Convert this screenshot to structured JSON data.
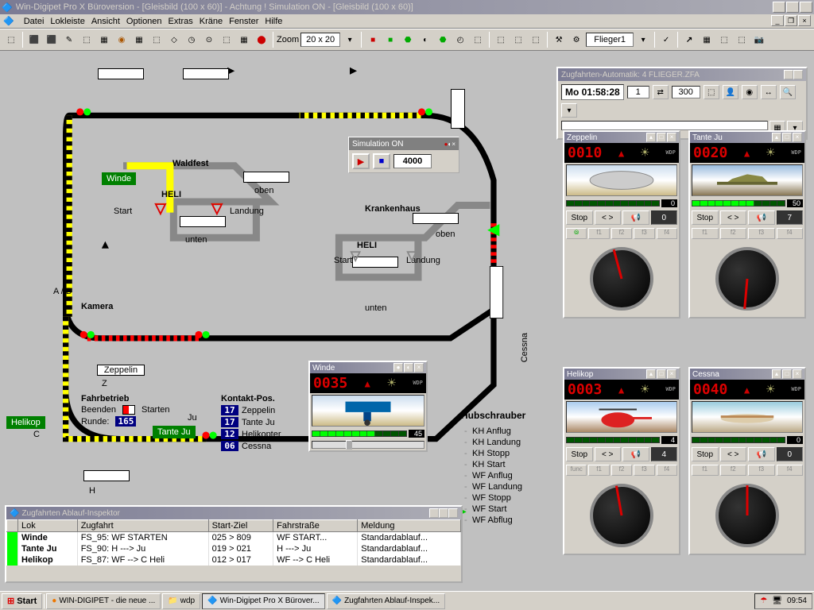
{
  "titlebar": "Win-Digipet Pro X Büroversion  - [Gleisbild (100 x 60)] - Achtung ! Simulation ON - [Gleisbild (100 x 60)]",
  "menu": [
    "Datei",
    "Lokleiste",
    "Ansicht",
    "Optionen",
    "Extras",
    "Kräne",
    "Fenster",
    "Hilfe"
  ],
  "toolbar": {
    "zoom_label": "Zoom",
    "zoom_value": "20 x 20",
    "flieger": "Flieger1"
  },
  "automation": {
    "title": "Zugfahrten-Automatik: 4 FLIEGER.ZFA",
    "clock": "Mo 01:58:28",
    "val1": "1",
    "val2": "300"
  },
  "simulation": {
    "title": "Simulation ON",
    "value": "4000"
  },
  "labels": {
    "winde": "Winde",
    "waldfest": "Waldfest",
    "heli": "HELI",
    "heli2": "HELI",
    "start": "Start",
    "landung": "Landung",
    "start2": "Start",
    "landung2": "Landung",
    "oben": "oben",
    "unten": "unten",
    "oben2": "oben",
    "unten2": "unten",
    "krankenhaus": "Krankenhaus",
    "kamera": "Kamera",
    "ab": "A / B",
    "zeppelin": "Zeppelin",
    "z": "Z",
    "helikop": "Helikop",
    "c": "C",
    "tanteju": "Tante Ju",
    "ju": "Ju",
    "h": "H",
    "cessna_v": "Cessna"
  },
  "fahrbetrieb": {
    "title": "Fahrbetrieb",
    "beenden": "Beenden",
    "starten": "Starten",
    "runde": "Runde:",
    "runde_val": "165"
  },
  "kontakt": {
    "title": "Kontakt-Pos.",
    "rows": [
      {
        "n": "17",
        "l": "Zeppelin"
      },
      {
        "n": "17",
        "l": "Tante Ju"
      },
      {
        "n": "12",
        "l": "Helikopter"
      },
      {
        "n": "06",
        "l": "Cessna"
      }
    ]
  },
  "hubschrauber": {
    "title": "Hubschrauber",
    "items": [
      "KH Anflug",
      "KH Landung",
      "KH Stopp",
      "KH Start",
      "WF Anflug",
      "WF Landung",
      "WF Stopp",
      "WF Start",
      "WF Abflug"
    ],
    "active": 7
  },
  "locos": {
    "zeppelin": {
      "name": "Zeppelin",
      "speed": "0010",
      "bar": "0",
      "ctrl": "Stop",
      "ctrl_val": "0",
      "fn": [
        "f1",
        "f2",
        "f3",
        "f4"
      ],
      "fn0": "⦾"
    },
    "tante": {
      "name": "Tante Ju",
      "speed": "0020",
      "bar": "50",
      "ctrl": "Stop",
      "ctrl_val": "7",
      "fn": [
        "f1",
        "f2",
        "f3",
        "f4"
      ]
    },
    "helikop": {
      "name": "Helikop",
      "speed": "0003",
      "bar": "4",
      "ctrl": "Stop",
      "ctrl_val": "4",
      "fn": [
        "f1",
        "f2",
        "f3",
        "f4"
      ],
      "fn_extra": "func"
    },
    "cessna": {
      "name": "Cessna",
      "speed": "0040",
      "bar": "0",
      "ctrl": "Stop",
      "ctrl_val": "0",
      "fn": [
        "f1",
        "f2",
        "f3",
        "f4"
      ]
    },
    "winde": {
      "name": "Winde",
      "speed": "0035",
      "bar": "45"
    }
  },
  "inspector": {
    "title": "Zugfahrten Ablauf-Inspektor",
    "headers": [
      "Lok",
      "Zugfahrt",
      "Start-Ziel",
      "Fahrstraße",
      "Meldung"
    ],
    "rows": [
      {
        "lok": "Winde",
        "zug": "FS_95: WF STARTEN",
        "sz": "025 > 809",
        "fs": "WF START...",
        "m": "Standardablauf..."
      },
      {
        "lok": "Tante Ju",
        "zug": "FS_90: H ---> Ju",
        "sz": "019 > 021",
        "fs": "H ---> Ju",
        "m": "Standardablauf..."
      },
      {
        "lok": "Helikop",
        "zug": "FS_87: WF --> C Heli",
        "sz": "012 > 017",
        "fs": "WF --> C Heli",
        "m": "Standardablauf..."
      }
    ]
  },
  "taskbar": {
    "start": "Start",
    "items": [
      "WIN-DIGIPET - die neue ...",
      "wdp",
      "Win-Digipet Pro X Bürover...",
      "Zugfahrten Ablauf-Inspek..."
    ],
    "time": "09:54"
  }
}
